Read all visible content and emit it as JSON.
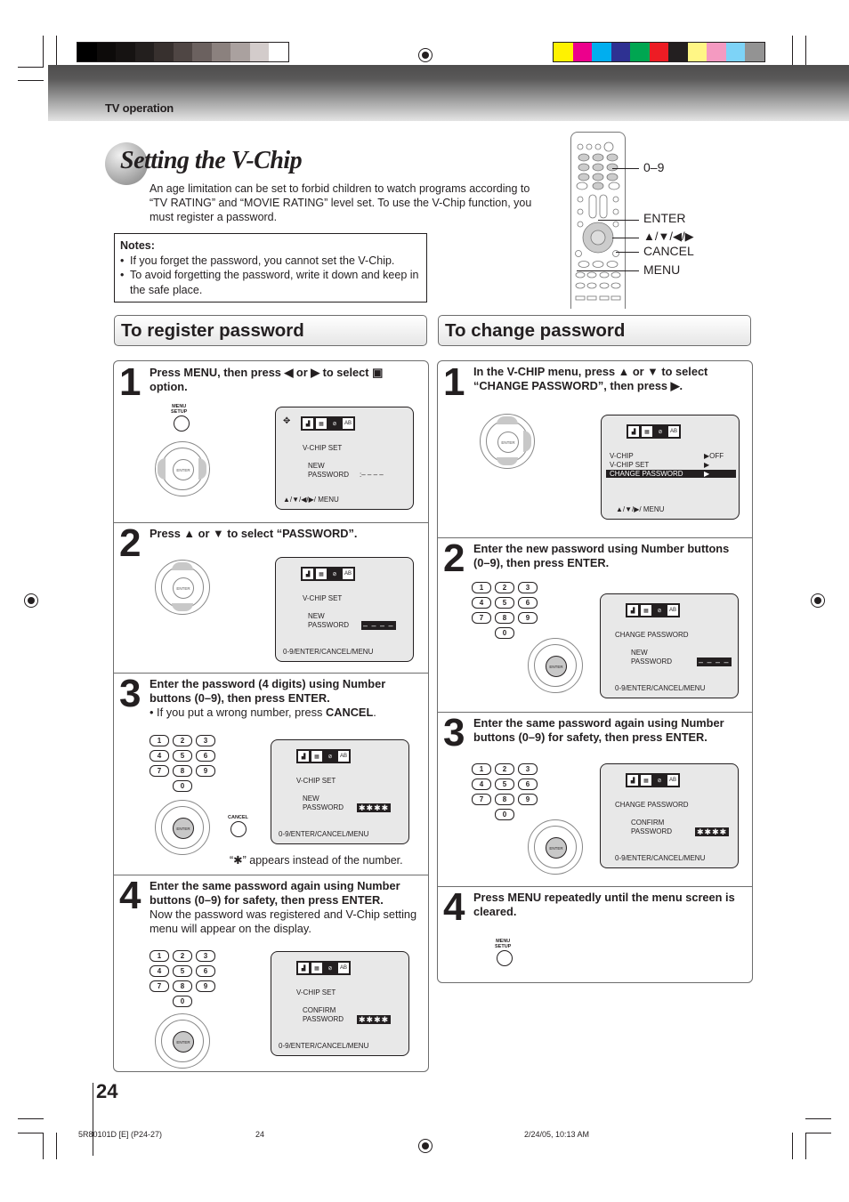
{
  "header": {
    "section_label": "TV operation"
  },
  "page": {
    "title": "Setting the V-Chip",
    "intro": "An age limitation can be set to forbid children to watch programs according to “TV RATING” and “MOVIE RATING” level set. To use the V-Chip function, you must register a password.",
    "notes": {
      "heading": "Notes:",
      "items": [
        "If you forget the password, you cannot set the V-Chip.",
        "To avoid forgetting the password, write it down and keep in the safe place."
      ]
    },
    "remote_labels": {
      "numbers": "0–9",
      "enter": "ENTER",
      "arrows": "▲/▼/◀/▶",
      "cancel": "CANCEL",
      "menu": "MENU"
    },
    "page_number": "24"
  },
  "register": {
    "heading": "To register password",
    "steps": [
      {
        "num": "1",
        "text": "Press MENU, then press ◀ or ▶ to select ▣ option.",
        "screen": {
          "title": "V-CHIP  SET",
          "label1": "NEW",
          "label2": "PASSWORD",
          "value": ":– – – –",
          "footer": "▲/▼/◀/▶/ MENU"
        },
        "button_label": "MENU\nSETUP"
      },
      {
        "num": "2",
        "text": "Press ▲ or ▼ to select “PASSWORD”.",
        "screen": {
          "title": "V-CHIP  SET",
          "label1": "NEW",
          "label2": "PASSWORD",
          "value": "– – – –",
          "footer": "0-9/ENTER/CANCEL/MENU"
        }
      },
      {
        "num": "3",
        "text": "Enter the password (4 digits) using Number buttons (0–9), then press ENTER.",
        "subtext_pre": "• If you put a wrong number, press ",
        "subtext_bold": "CANCEL",
        "subtext_post": ".",
        "screen": {
          "title": "V-CHIP  SET",
          "label1": "NEW",
          "label2": "PASSWORD",
          "value": "✱✱✱✱",
          "footer": "0-9/ENTER/CANCEL/MENU"
        },
        "button_label": "CANCEL",
        "caption": "“✱” appears instead of the number."
      },
      {
        "num": "4",
        "text": "Enter the same password again using Number buttons (0–9) for safety, then press ENTER.",
        "subtext": "Now the password was registered and V-Chip setting menu will appear on the display.",
        "screen": {
          "title": "V-CHIP  SET",
          "label1": "CONFIRM",
          "label2": "PASSWORD",
          "value": "✱✱✱✱",
          "footer": "0-9/ENTER/CANCEL/MENU"
        }
      }
    ]
  },
  "change": {
    "heading": "To change password",
    "steps": [
      {
        "num": "1",
        "text": "In the V-CHIP menu, press ▲ or ▼ to select “CHANGE PASSWORD”, then press ▶.",
        "screen": {
          "rows": [
            {
              "label": "V-CHIP",
              "value": "▶OFF"
            },
            {
              "label": "V-CHIP SET",
              "value": "▶"
            },
            {
              "label": "CHANGE PASSWORD",
              "value": "▶"
            }
          ],
          "footer": "▲/▼/▶/ MENU"
        }
      },
      {
        "num": "2",
        "text": "Enter the new password using Number buttons (0–9), then press ENTER.",
        "screen": {
          "title": "CHANGE  PASSWORD",
          "label1": "NEW",
          "label2": "PASSWORD",
          "value": "– – – –",
          "footer": "0-9/ENTER/CANCEL/MENU"
        }
      },
      {
        "num": "3",
        "text": "Enter the same password again using Number buttons (0–9) for safety, then press ENTER.",
        "screen": {
          "title": "CHANGE  PASSWORD",
          "label1": "CONFIRM",
          "label2": "PASSWORD",
          "value": "✱✱✱✱",
          "footer": "0-9/ENTER/CANCEL/MENU"
        }
      },
      {
        "num": "4",
        "text": "Press MENU repeatedly until the menu screen is cleared.",
        "button_label": "MENU\nSETUP"
      }
    ]
  },
  "icons": {
    "menu_icons": [
      "PIC",
      "CH",
      "⊘",
      "AB\nCD"
    ],
    "enter_label": "ENTER"
  },
  "numpad": [
    "1",
    "2",
    "3",
    "4",
    "5",
    "6",
    "7",
    "8",
    "9",
    "0"
  ],
  "footer": {
    "code": "5R80101D [E] (P24-27)",
    "page": "24",
    "timestamp": "2/24/05, 10:13 AM"
  },
  "colors": {
    "gray_ramp": [
      "#000000",
      "#0d0b0a",
      "#161312",
      "#231f1e",
      "#37302e",
      "#4f4644",
      "#6b615f",
      "#8b817e",
      "#aaa19f",
      "#d3cccb",
      "#ffffff"
    ],
    "color_bar": [
      "#fff200",
      "#ec008c",
      "#00aeef",
      "#2e3192",
      "#00a651",
      "#ed1c24",
      "#231f20",
      "#fff685",
      "#f49ac1",
      "#7dd3f7",
      "#939393"
    ]
  }
}
